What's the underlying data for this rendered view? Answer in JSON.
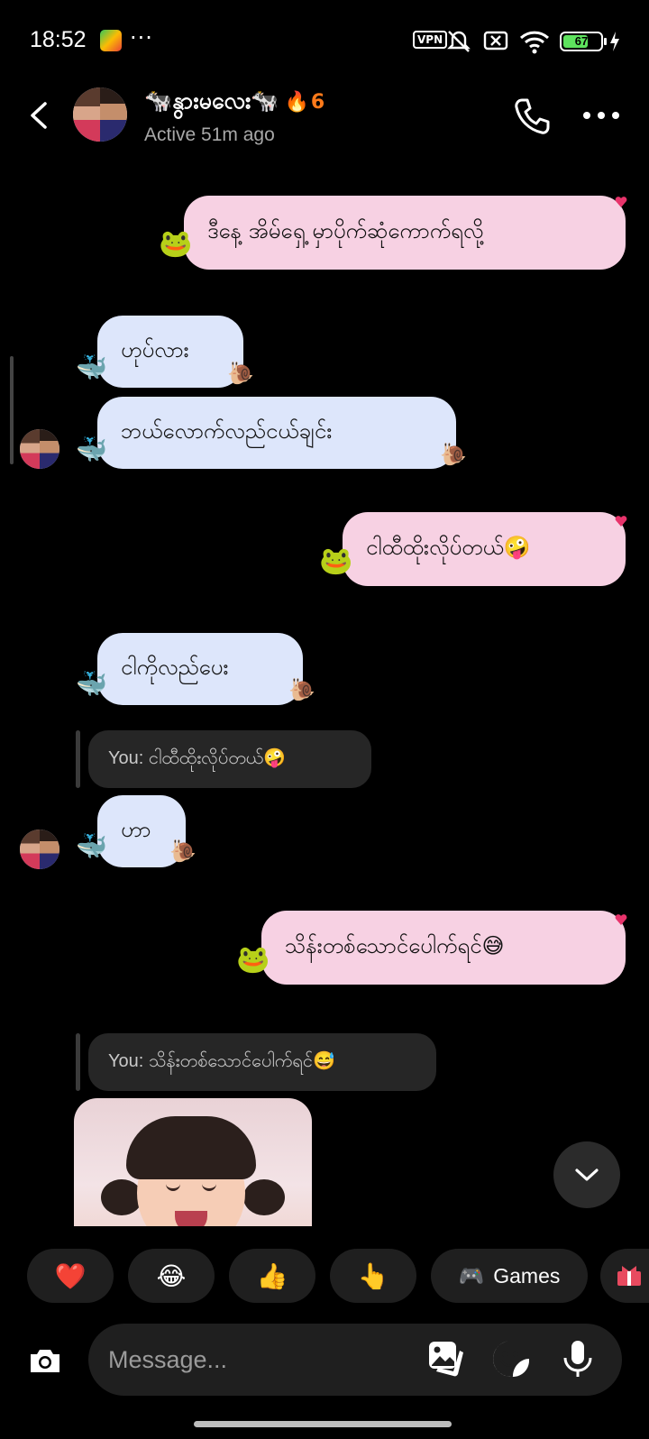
{
  "status_bar": {
    "time": "18:52",
    "more": "···",
    "vpn": "VPN",
    "battery": "67",
    "battery_level": 0.67,
    "battery_color": "#5ee35e"
  },
  "header": {
    "name": "🐄နွားမလေး🐄",
    "streak_icon": "🔥",
    "streak_count": "6",
    "status": "Active 51m ago"
  },
  "messages": [
    {
      "direction": "out",
      "text": "ဒီနေ့ အိမ်ရှေ့ မှာပိုက်ဆုံကောက်ရလို့"
    },
    {
      "direction": "in",
      "text": "ဟုပ်လား"
    },
    {
      "direction": "in",
      "text": "ဘယ်လောက်လည်ငယ်ချင်း"
    },
    {
      "direction": "out",
      "text": "ငါထီထိုးလိုပ်တယ်🤪"
    },
    {
      "direction": "in",
      "text": "ငါကိုလည်ပေး"
    },
    {
      "direction": "in",
      "text": "ဟာ"
    },
    {
      "direction": "out",
      "text": "သိန်းတစ်သောင်ပေါက်ရင်😅"
    }
  ],
  "replies": [
    "You: ငါထီထိုးလိုပ်တယ်🤪",
    "You: သိန်းတစ်သောင်ပေါက်ရင်😅"
  ],
  "stickers": {
    "frog": "🐸",
    "whale": "🐳",
    "snail": "🐌",
    "heart": "❤"
  },
  "quick_reactions": [
    "❤️",
    "😂",
    "👍",
    "👆"
  ],
  "games_chip": {
    "icon": "🎮",
    "label": "Games"
  },
  "composer": {
    "placeholder": "Message..."
  },
  "colors": {
    "outgoing_bubble": "#f7d1e3",
    "incoming_bubble": "#dde6fb",
    "background": "#000000",
    "chip": "#1f1f1f",
    "streak": "#ff7a1a",
    "heart": "#e8336b"
  }
}
